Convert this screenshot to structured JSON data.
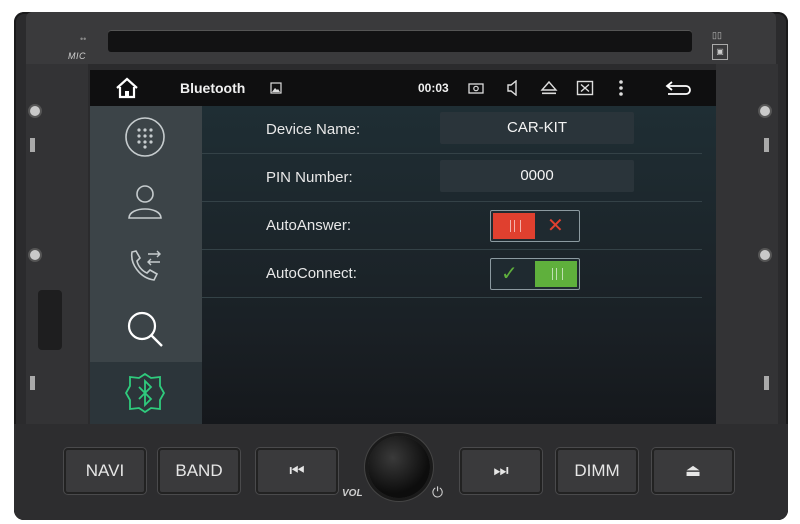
{
  "device": {
    "mic_label": "MIC",
    "vol_label": "VOL",
    "buttons": [
      {
        "id": "navi",
        "label": "NAVI"
      },
      {
        "id": "band",
        "label": "BAND"
      },
      {
        "id": "prev",
        "label": "⏮"
      },
      {
        "id": "next",
        "label": "⏭"
      },
      {
        "id": "dimm",
        "label": "DIMM"
      },
      {
        "id": "eject",
        "label": "⏏"
      }
    ]
  },
  "statusbar": {
    "title": "Bluetooth",
    "time": "00:03"
  },
  "sidebar": {
    "items": [
      {
        "name": "dialpad",
        "icon": "dialpad-icon"
      },
      {
        "name": "contacts",
        "icon": "contact-icon"
      },
      {
        "name": "call-log",
        "icon": "call-log-icon"
      },
      {
        "name": "search",
        "icon": "search-icon"
      },
      {
        "name": "bluetooth",
        "icon": "bluetooth-icon",
        "active": true
      }
    ]
  },
  "settings": {
    "device_name_label": "Device Name:",
    "device_name_value": "CAR-KIT",
    "pin_label": "PIN Number:",
    "pin_value": "0000",
    "auto_answer_label": "AutoAnswer:",
    "auto_answer_enabled": false,
    "auto_connect_label": "AutoConnect:",
    "auto_connect_enabled": true
  },
  "colors": {
    "accent": "#2fcb7d",
    "toggle_off": "#e0402f",
    "toggle_on": "#5fb03c"
  }
}
